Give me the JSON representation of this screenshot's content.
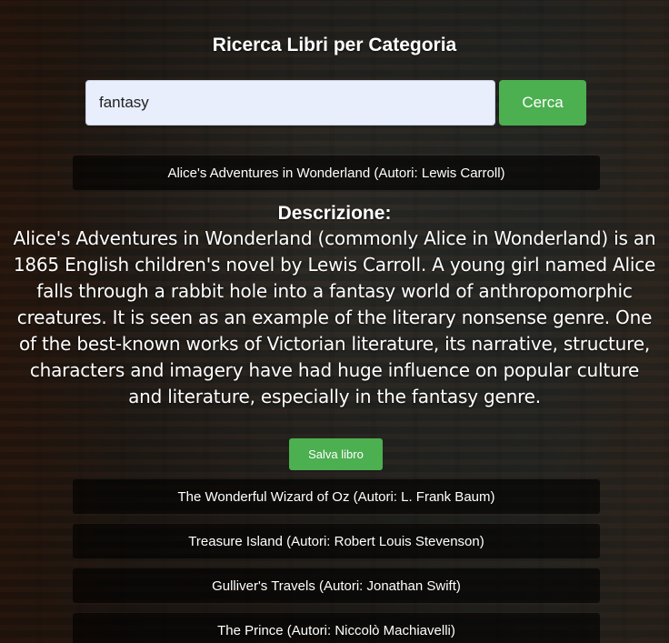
{
  "header": {
    "title": "Ricerca Libri per Categoria"
  },
  "search": {
    "value": "fantasy",
    "button_label": "Cerca"
  },
  "selected_book": {
    "label": "Alice's Adventures in Wonderland (Autori: Lewis Carroll)",
    "description_heading": "Descrizione:",
    "description": "Alice's Adventures in Wonderland (commonly Alice in Wonderland) is an 1865 English children's novel by Lewis Carroll. A young girl named Alice falls through a rabbit hole into a fantasy world of anthropomorphic creatures. It is seen as an example of the literary nonsense genre. One of the best-known works of Victorian literature, its narrative, structure, characters and imagery have had huge influence on popular culture and literature, especially in the fantasy genre.",
    "save_label": "Salva libro"
  },
  "results": [
    {
      "label": "The Wonderful Wizard of Oz (Autori: L. Frank Baum)"
    },
    {
      "label": "Treasure Island (Autori: Robert Louis Stevenson)"
    },
    {
      "label": "Gulliver's Travels (Autori: Jonathan Swift)"
    },
    {
      "label": "The Prince (Autori: Niccolò Machiavelli)"
    }
  ],
  "colors": {
    "accent": "#4caf50",
    "result_bg": "rgba(0,0,0,0.62)",
    "input_bg": "#e9eefc"
  }
}
